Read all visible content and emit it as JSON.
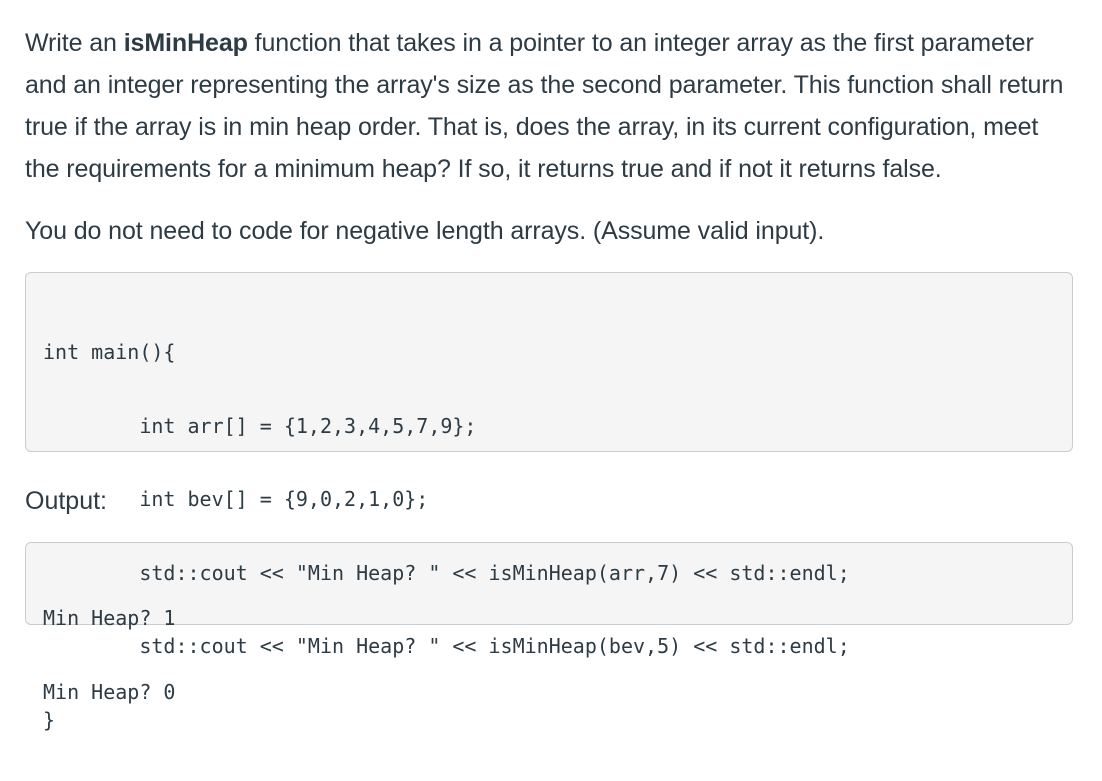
{
  "question": {
    "p1_before": "Write an ",
    "p1_bold": "isMinHeap",
    "p1_after": " function that takes in a pointer to an integer array as the first parameter and an integer representing the array's size as the second parameter. This function shall return true if the array is in min heap order. That is, does the array, in its current configuration, meet the requirements for a minimum heap? If so, it returns true and if not it returns false.",
    "p2": "You do not need to code for negative length arrays. (Assume valid input)."
  },
  "code": {
    "lines": [
      "int main(){",
      "        int arr[] = {1,2,3,4,5,7,9};",
      "        int bev[] = {9,0,2,1,0};",
      "        std::cout << \"Min Heap? \" << isMinHeap(arr,7) << std::endl;",
      "        std::cout << \"Min Heap? \" << isMinHeap(bev,5) << std::endl;",
      "}"
    ]
  },
  "output": {
    "label": "Output:",
    "lines": [
      "Min Heap? 1",
      "Min Heap? 0"
    ]
  }
}
